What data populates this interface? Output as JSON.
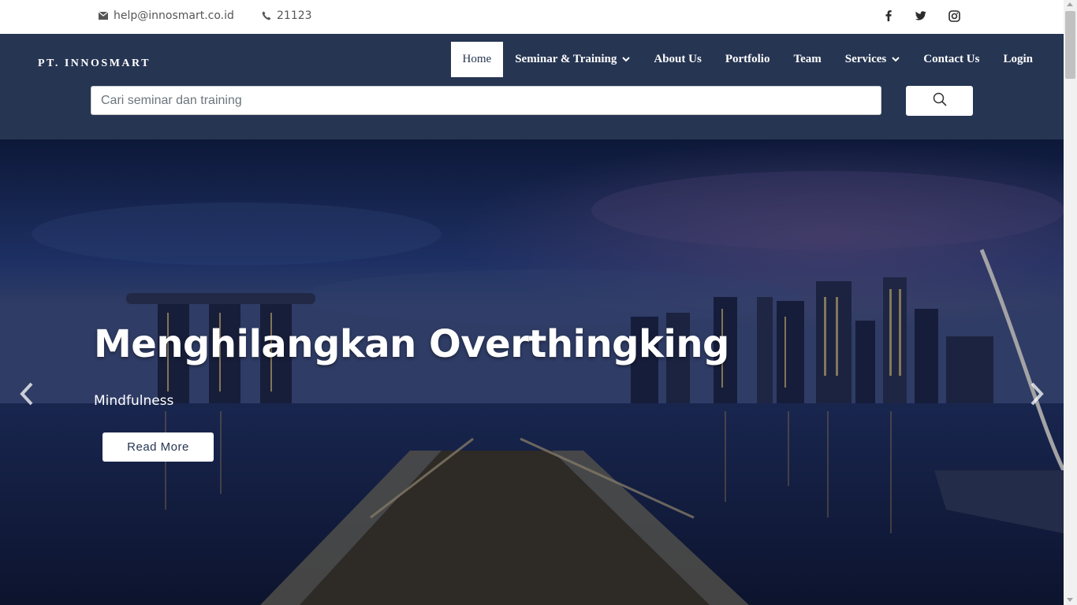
{
  "topbar": {
    "email": "help@innosmart.co.id",
    "phone": "21123",
    "email_icon": "envelope-icon",
    "phone_icon": "phone-icon",
    "social": [
      "facebook-icon",
      "twitter-icon",
      "instagram-icon"
    ]
  },
  "header": {
    "brand": "PT. INNOSMART",
    "nav": {
      "home": "Home",
      "seminar": "Seminar & Training",
      "about": "About Us",
      "portfolio": "Portfolio",
      "team": "Team",
      "services": "Services",
      "contact": "Contact Us",
      "login": "Login"
    },
    "active_nav": "Home",
    "search": {
      "placeholder": "Cari seminar dan training",
      "value": ""
    }
  },
  "hero": {
    "title": "Menghilangkan Overthingking",
    "subtitle": "Mindfulness",
    "button": "Read More"
  },
  "colors": {
    "header_bg": "#263552",
    "topbar_bg": "#ffffff",
    "accent_text": "#ffffff"
  }
}
